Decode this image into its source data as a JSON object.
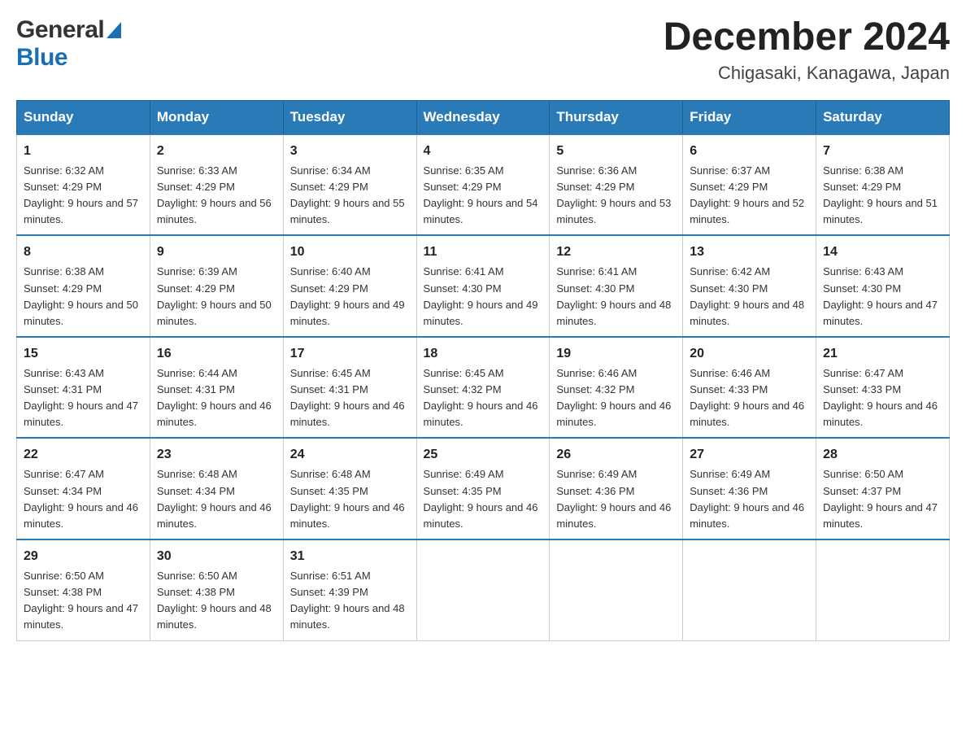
{
  "logo": {
    "general": "General",
    "blue": "Blue"
  },
  "title": "December 2024",
  "location": "Chigasaki, Kanagawa, Japan",
  "days": [
    "Sunday",
    "Monday",
    "Tuesday",
    "Wednesday",
    "Thursday",
    "Friday",
    "Saturday"
  ],
  "weeks": [
    [
      {
        "num": "1",
        "sunrise": "6:32 AM",
        "sunset": "4:29 PM",
        "daylight": "9 hours and 57 minutes."
      },
      {
        "num": "2",
        "sunrise": "6:33 AM",
        "sunset": "4:29 PM",
        "daylight": "9 hours and 56 minutes."
      },
      {
        "num": "3",
        "sunrise": "6:34 AM",
        "sunset": "4:29 PM",
        "daylight": "9 hours and 55 minutes."
      },
      {
        "num": "4",
        "sunrise": "6:35 AM",
        "sunset": "4:29 PM",
        "daylight": "9 hours and 54 minutes."
      },
      {
        "num": "5",
        "sunrise": "6:36 AM",
        "sunset": "4:29 PM",
        "daylight": "9 hours and 53 minutes."
      },
      {
        "num": "6",
        "sunrise": "6:37 AM",
        "sunset": "4:29 PM",
        "daylight": "9 hours and 52 minutes."
      },
      {
        "num": "7",
        "sunrise": "6:38 AM",
        "sunset": "4:29 PM",
        "daylight": "9 hours and 51 minutes."
      }
    ],
    [
      {
        "num": "8",
        "sunrise": "6:38 AM",
        "sunset": "4:29 PM",
        "daylight": "9 hours and 50 minutes."
      },
      {
        "num": "9",
        "sunrise": "6:39 AM",
        "sunset": "4:29 PM",
        "daylight": "9 hours and 50 minutes."
      },
      {
        "num": "10",
        "sunrise": "6:40 AM",
        "sunset": "4:29 PM",
        "daylight": "9 hours and 49 minutes."
      },
      {
        "num": "11",
        "sunrise": "6:41 AM",
        "sunset": "4:30 PM",
        "daylight": "9 hours and 49 minutes."
      },
      {
        "num": "12",
        "sunrise": "6:41 AM",
        "sunset": "4:30 PM",
        "daylight": "9 hours and 48 minutes."
      },
      {
        "num": "13",
        "sunrise": "6:42 AM",
        "sunset": "4:30 PM",
        "daylight": "9 hours and 48 minutes."
      },
      {
        "num": "14",
        "sunrise": "6:43 AM",
        "sunset": "4:30 PM",
        "daylight": "9 hours and 47 minutes."
      }
    ],
    [
      {
        "num": "15",
        "sunrise": "6:43 AM",
        "sunset": "4:31 PM",
        "daylight": "9 hours and 47 minutes."
      },
      {
        "num": "16",
        "sunrise": "6:44 AM",
        "sunset": "4:31 PM",
        "daylight": "9 hours and 46 minutes."
      },
      {
        "num": "17",
        "sunrise": "6:45 AM",
        "sunset": "4:31 PM",
        "daylight": "9 hours and 46 minutes."
      },
      {
        "num": "18",
        "sunrise": "6:45 AM",
        "sunset": "4:32 PM",
        "daylight": "9 hours and 46 minutes."
      },
      {
        "num": "19",
        "sunrise": "6:46 AM",
        "sunset": "4:32 PM",
        "daylight": "9 hours and 46 minutes."
      },
      {
        "num": "20",
        "sunrise": "6:46 AM",
        "sunset": "4:33 PM",
        "daylight": "9 hours and 46 minutes."
      },
      {
        "num": "21",
        "sunrise": "6:47 AM",
        "sunset": "4:33 PM",
        "daylight": "9 hours and 46 minutes."
      }
    ],
    [
      {
        "num": "22",
        "sunrise": "6:47 AM",
        "sunset": "4:34 PM",
        "daylight": "9 hours and 46 minutes."
      },
      {
        "num": "23",
        "sunrise": "6:48 AM",
        "sunset": "4:34 PM",
        "daylight": "9 hours and 46 minutes."
      },
      {
        "num": "24",
        "sunrise": "6:48 AM",
        "sunset": "4:35 PM",
        "daylight": "9 hours and 46 minutes."
      },
      {
        "num": "25",
        "sunrise": "6:49 AM",
        "sunset": "4:35 PM",
        "daylight": "9 hours and 46 minutes."
      },
      {
        "num": "26",
        "sunrise": "6:49 AM",
        "sunset": "4:36 PM",
        "daylight": "9 hours and 46 minutes."
      },
      {
        "num": "27",
        "sunrise": "6:49 AM",
        "sunset": "4:36 PM",
        "daylight": "9 hours and 46 minutes."
      },
      {
        "num": "28",
        "sunrise": "6:50 AM",
        "sunset": "4:37 PM",
        "daylight": "9 hours and 47 minutes."
      }
    ],
    [
      {
        "num": "29",
        "sunrise": "6:50 AM",
        "sunset": "4:38 PM",
        "daylight": "9 hours and 47 minutes."
      },
      {
        "num": "30",
        "sunrise": "6:50 AM",
        "sunset": "4:38 PM",
        "daylight": "9 hours and 48 minutes."
      },
      {
        "num": "31",
        "sunrise": "6:51 AM",
        "sunset": "4:39 PM",
        "daylight": "9 hours and 48 minutes."
      },
      null,
      null,
      null,
      null
    ]
  ]
}
